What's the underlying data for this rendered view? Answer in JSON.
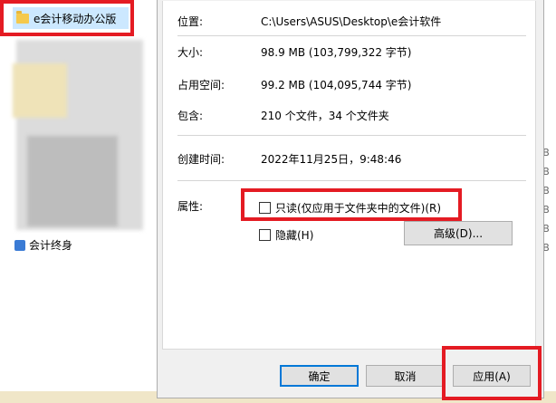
{
  "explorer": {
    "folder_name": "e会计移动办公版",
    "bottom_file_name": "会计终身",
    "size_units": [
      "KB",
      "KB",
      "KB",
      "KB",
      "KB",
      "KB"
    ]
  },
  "dialog": {
    "location": {
      "label": "位置:",
      "value": "C:\\Users\\ASUS\\Desktop\\e会计软件"
    },
    "size": {
      "label": "大小:",
      "value": "98.9 MB (103,799,322 字节)"
    },
    "size_on_disk": {
      "label": "占用空间:",
      "value": "99.2 MB (104,095,744 字节)"
    },
    "contains": {
      "label": "包含:",
      "value": "210 个文件，34 个文件夹"
    },
    "created": {
      "label": "创建时间:",
      "value": "2022年11月25日，9:48:46"
    },
    "attributes": {
      "label": "属性:",
      "readonly_label": "只读(仅应用于文件夹中的文件)(R)",
      "hidden_label": "隐藏(H)",
      "advanced_button": "高级(D)..."
    },
    "buttons": {
      "ok": "确定",
      "cancel": "取消",
      "apply": "应用(A)"
    }
  },
  "colors": {
    "highlight": "#e41b23",
    "selection": "#cce8ff",
    "accent": "#0078d7"
  }
}
